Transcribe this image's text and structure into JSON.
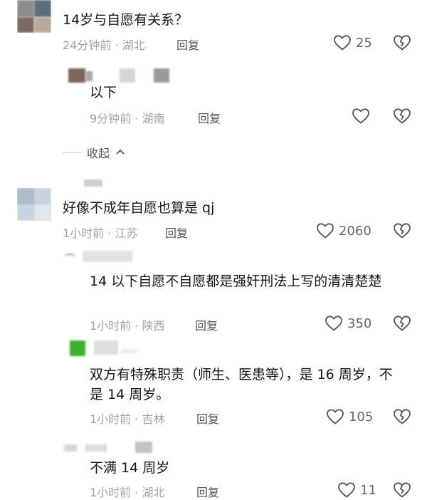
{
  "comments": [
    {
      "text": "14岁与自愿有关系？",
      "meta": "24分钟前 · 湖北",
      "reply": "回复",
      "likes": "25"
    },
    {
      "text": "以下",
      "meta": "9分钟前 · 湖南",
      "reply": "回复",
      "likes": ""
    },
    {
      "text": "好像不成年自愿也算是 qj",
      "meta": "1小时前 · 江苏",
      "reply": "回复",
      "likes": "2060"
    },
    {
      "text": "14 以下自愿不自愿都是强奸刑法上写的清清楚楚",
      "meta": "1小时前 · 陕西",
      "reply": "回复",
      "likes": "350"
    },
    {
      "text": "双方有特殊职责（师生、医患等），是 16 周岁，不是 14 周岁。",
      "meta": "1小时前 · 吉林",
      "reply": "回复",
      "likes": "105"
    },
    {
      "text": "不满 14 周岁",
      "meta": "1小时前 · 湖北",
      "reply": "回复",
      "likes": "11"
    }
  ],
  "collapse_label": "收起",
  "icons": {
    "like": "heart-outline-icon",
    "dislike": "broken-heart-icon",
    "collapse": "chevron-up-icon"
  }
}
